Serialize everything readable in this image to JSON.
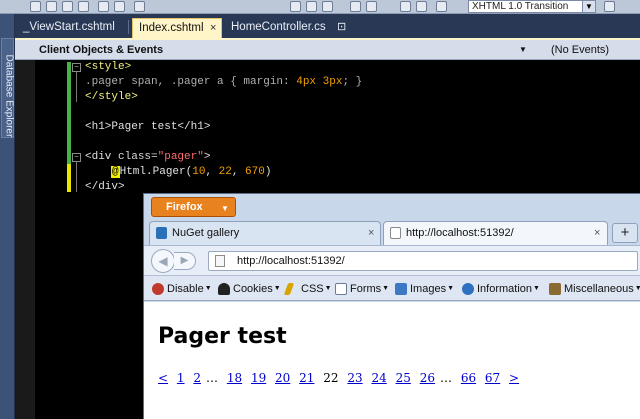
{
  "toolbar": {
    "combo_value": "XHTML 1.0 Transition"
  },
  "left_panel": {
    "label": "Database Explorer"
  },
  "tabs": [
    {
      "label": "_ViewStart.cshtml",
      "active": false
    },
    {
      "label": "Index.cshtml",
      "active": true,
      "close": "×"
    },
    {
      "label": "HomeController.cs",
      "active": false,
      "close": "⊡"
    }
  ],
  "nav_bar": {
    "left": "Client Objects & Events",
    "right": "(No Events)"
  },
  "code": {
    "line1_open": "<style>",
    "line2_css": ".pager span, .pager a { margin: ",
    "line2_num1": "4px",
    "line2_space": " ",
    "line2_num2": "3px",
    "line2_end": "; }",
    "line3": "</style>",
    "line5": "<h1>Pager test</h1>",
    "line7_open": "<div ",
    "line7_attr": "class=",
    "line7_val": "\"pager\"",
    "line7_close": ">",
    "line8_at": "@",
    "line8_call": "Html.Pager(",
    "line8_a1": "10",
    "line8_c1": ", ",
    "line8_a2": "22",
    "line8_c2": ", ",
    "line8_a3": "670",
    "line8_end": ")",
    "line9": "</div>"
  },
  "firefox": {
    "button_label": "Firefox",
    "tabs": [
      {
        "label": "NuGet gallery",
        "close": "×"
      },
      {
        "label": "http://localhost:51392/",
        "close": "×"
      }
    ],
    "new_tab": "+",
    "url": "http://localhost:51392/",
    "webdev_toolbar": [
      {
        "label": "Disable",
        "icon": "disable-icon",
        "color": "#c0392b"
      },
      {
        "label": "Cookies",
        "icon": "cookies-icon",
        "color": "#222222"
      },
      {
        "label": "CSS",
        "icon": "css-icon",
        "color": "#d9a400"
      },
      {
        "label": "Forms",
        "icon": "forms-icon",
        "color": "#6b7d95"
      },
      {
        "label": "Images",
        "icon": "images-icon",
        "color": "#3d78c4"
      },
      {
        "label": "Information",
        "icon": "information-icon",
        "color": "#2f6fbf"
      },
      {
        "label": "Miscellaneous",
        "icon": "miscellaneous-icon",
        "color": "#8a6a30"
      }
    ],
    "page": {
      "heading": "Pager test",
      "pager": {
        "prev": "<",
        "link1": "1",
        "link2": "2",
        "ellipsis1": "…",
        "link18": "18",
        "link19": "19",
        "link20": "20",
        "link21": "21",
        "current": "22",
        "link23": "23",
        "link24": "24",
        "link25": "25",
        "link26": "26",
        "ellipsis2": "…",
        "link66": "66",
        "link67": "67",
        "next": ">"
      }
    }
  }
}
